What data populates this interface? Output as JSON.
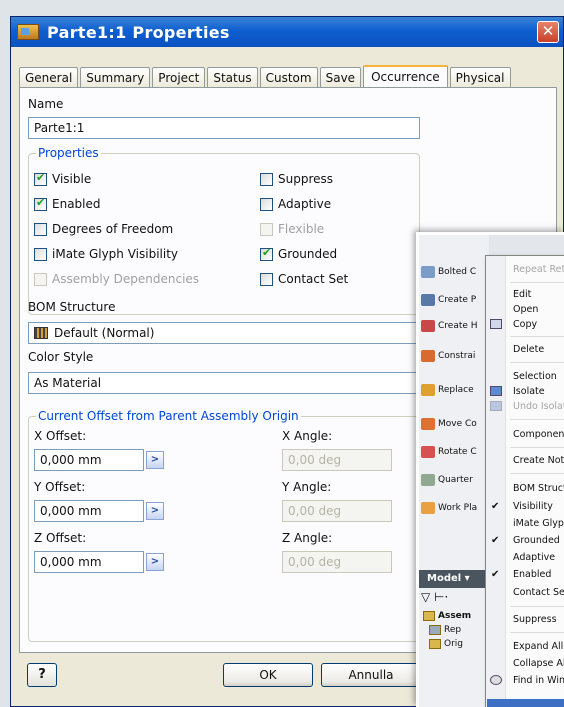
{
  "dialog": {
    "title": "Parte1:1 Properties",
    "close_glyph": "✕",
    "tabs": [
      {
        "label": "General"
      },
      {
        "label": "Summary"
      },
      {
        "label": "Project"
      },
      {
        "label": "Status"
      },
      {
        "label": "Custom"
      },
      {
        "label": "Save"
      },
      {
        "label": "Occurrence",
        "active": true
      },
      {
        "label": "Physical"
      }
    ],
    "name_label": "Name",
    "name_value": "Parte1:1",
    "properties_group": "Properties",
    "checkboxes": {
      "visible": {
        "label": "Visible",
        "checked": true,
        "enabled": true
      },
      "enabled": {
        "label": "Enabled",
        "checked": true,
        "enabled": true
      },
      "dof": {
        "label": "Degrees of Freedom",
        "checked": false,
        "enabled": true
      },
      "imate": {
        "label": "iMate Glyph Visibility",
        "checked": false,
        "enabled": true
      },
      "assembly_dep": {
        "label": "Assembly Dependencies",
        "checked": false,
        "enabled": false
      },
      "suppress": {
        "label": "Suppress",
        "checked": false,
        "enabled": true
      },
      "adaptive": {
        "label": "Adaptive",
        "checked": false,
        "enabled": true
      },
      "flexible": {
        "label": "Flexible",
        "checked": false,
        "enabled": false
      },
      "grounded": {
        "label": "Grounded",
        "checked": true,
        "enabled": true
      },
      "contact_set": {
        "label": "Contact Set",
        "checked": false,
        "enabled": true
      }
    },
    "bom_label": "BOM Structure",
    "bom_value": "Default (Normal)",
    "color_label": "Color Style",
    "color_value": "As Material",
    "offset_group": "Current Offset from Parent Assembly Origin",
    "x_offset_label": "X Offset:",
    "x_offset_value": "0,000 mm",
    "y_offset_label": "Y Offset:",
    "y_offset_value": "0,000 mm",
    "z_offset_label": "Z Offset:",
    "z_offset_value": "0,000 mm",
    "x_angle_label": "X Angle:",
    "x_angle_value": "0,00 deg",
    "y_angle_label": "Y Angle:",
    "y_angle_value": "0,00 deg",
    "z_angle_label": "Z Angle:",
    "z_angle_value": "0,00 deg",
    "help_label": "?",
    "ok_label": "OK",
    "cancel_label": "Annulla"
  },
  "overlay": {
    "panel_items": [
      {
        "label": "Bolted C",
        "icon": "bolted-connection-icon"
      },
      {
        "label": "Create P",
        "icon": "create-pattern-icon"
      },
      {
        "label": "Create H",
        "icon": "create-harness-icon"
      },
      {
        "label": "Constrai",
        "icon": "constraint-icon"
      },
      {
        "label": "Replace",
        "icon": "replace-component-icon"
      },
      {
        "label": "Move Co",
        "icon": "move-component-icon"
      },
      {
        "label": "Rotate C",
        "icon": "rotate-component-icon"
      },
      {
        "label": "Quarter",
        "icon": "quarter-section-icon"
      },
      {
        "label": "Work Pla",
        "icon": "work-plane-icon"
      }
    ],
    "model_label": "Model ▾",
    "tree_items": [
      {
        "label": "Assem"
      },
      {
        "label": "Rep"
      },
      {
        "label": "Orig"
      }
    ],
    "context_menu": [
      {
        "label": "Repeat Retu",
        "disabled": true
      },
      {
        "label": "Edit"
      },
      {
        "label": "Open"
      },
      {
        "label": "Copy"
      },
      {
        "label": "Delete"
      },
      {
        "label": "Selection"
      },
      {
        "label": "Isolate"
      },
      {
        "label": "Undo Isolate",
        "disabled": true
      },
      {
        "label": "Component"
      },
      {
        "label": "Create Note"
      },
      {
        "label": "BOM Structur"
      },
      {
        "label": "Visibility",
        "checked": true
      },
      {
        "label": "iMate Glyph V"
      },
      {
        "label": "Grounded",
        "checked": true
      },
      {
        "label": "Adaptive"
      },
      {
        "label": "Enabled",
        "checked": true
      },
      {
        "label": "Contact Set"
      },
      {
        "label": "Suppress"
      },
      {
        "label": "Expand All Cl"
      },
      {
        "label": "Collapse All C"
      },
      {
        "label": "Find in Windo"
      }
    ]
  }
}
